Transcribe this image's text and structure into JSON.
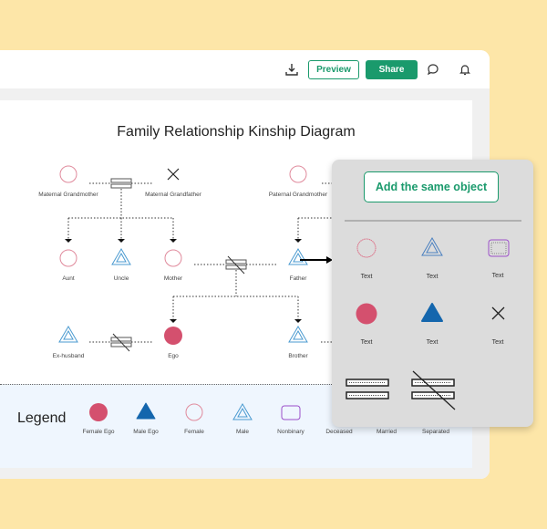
{
  "header": {
    "download_icon": "download-icon",
    "preview_label": "Preview",
    "share_label": "Share",
    "comment_icon": "comment-icon",
    "bell_icon": "bell-icon"
  },
  "diagram": {
    "title": "Family Relationship Kinship Diagram",
    "people": {
      "maternal_grandmother": "Maternal Grandmother",
      "maternal_grandfather": "Maternal Grandfather",
      "paternal_grandmother": "Paternal Grandmother",
      "aunt": "Aunt",
      "uncle": "Uncle",
      "mother": "Mother",
      "father": "Father",
      "ex_husband": "Ex-husband",
      "ego": "Ego",
      "brother": "Brother"
    }
  },
  "legend": {
    "title": "Legend",
    "items": [
      "Female Ego",
      "Male Ego",
      "Female",
      "Male",
      "Nonbinary",
      "Deceased",
      "Married",
      "Separated"
    ]
  },
  "popup": {
    "add_button": "Add the same object",
    "items": [
      "Text",
      "Text",
      "Text",
      "Text",
      "Text",
      "Text"
    ]
  },
  "colors": {
    "accent": "#1a9a6c",
    "female": "#d4506e",
    "male": "#1466ad",
    "nonbinary": "#9b4fc9",
    "background": "#fde6a8"
  }
}
